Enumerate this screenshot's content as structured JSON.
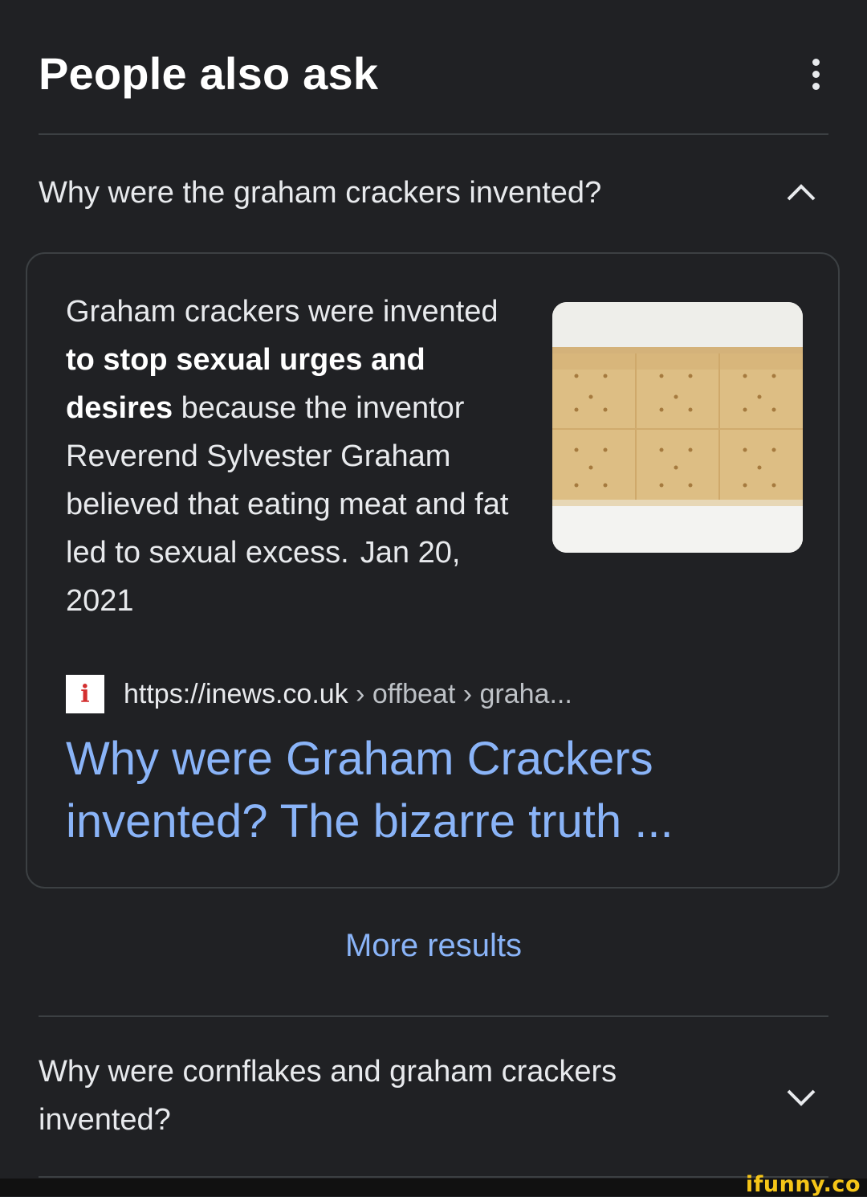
{
  "header": {
    "title": "People also ask",
    "menu_icon": "more-vert-icon"
  },
  "question_1": {
    "text": "Why were the graham crackers invented?",
    "state": "expanded",
    "icon": "chevron-up-icon"
  },
  "answer": {
    "part1": "Graham crackers were invented ",
    "bold": "to stop sexual urges and desires",
    "part2": " because the inventor Reverend Sylvester Graham believed that eating meat and fat led to sexual excess.",
    "date": "Jan 20, 2021",
    "image_subject": "graham crackers",
    "source": {
      "favicon_letter": "i",
      "host": "https://inews.co.uk",
      "path": " › offbeat › graha..."
    },
    "result_title": "Why were Graham Crackers invented? The bizarre truth ..."
  },
  "more_results_label": "More results",
  "question_2": {
    "text": "Why were cornflakes and graham crackers invented?",
    "state": "collapsed",
    "icon": "chevron-down-icon"
  },
  "watermark": "ifunny.co",
  "colors": {
    "background": "#202124",
    "link": "#8ab4f8",
    "divider": "#3c4043",
    "text": "#e8eaed"
  }
}
